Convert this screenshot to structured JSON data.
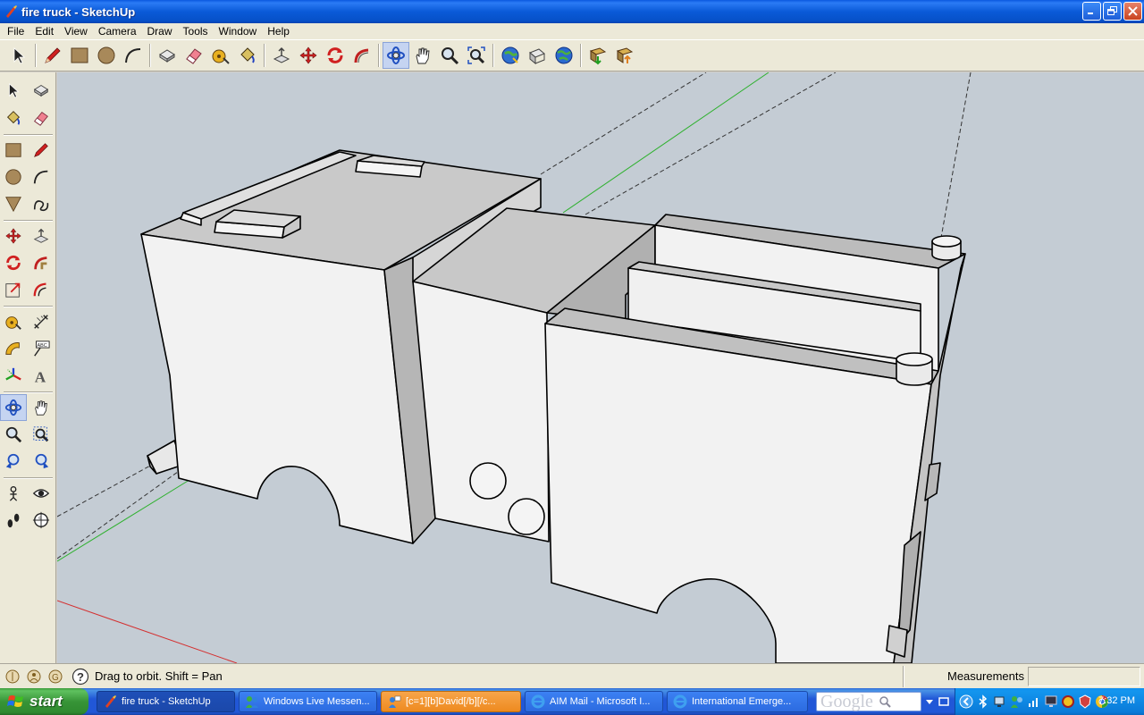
{
  "window": {
    "title": "fire truck - SketchUp",
    "buttons": [
      "minimize",
      "restore",
      "close"
    ]
  },
  "menubar": {
    "items": [
      "File",
      "Edit",
      "View",
      "Camera",
      "Draw",
      "Tools",
      "Window",
      "Help"
    ]
  },
  "top_toolbar": {
    "tools": [
      "select-icon",
      "pencil-icon",
      "rectangle-icon",
      "circle-icon",
      "arc-icon",
      "make-component-icon",
      "eraser-icon",
      "tape-measure-icon",
      "paint-bucket-icon",
      "push-pull-icon",
      "move-icon",
      "rotate-icon",
      "follow-me-icon",
      "orbit-icon",
      "pan-icon",
      "zoom-icon",
      "zoom-extents-icon",
      "get-models-icon",
      "share-model-icon",
      "google-earth-icon",
      "get-current-view-icon",
      "toggle-terrain-icon"
    ],
    "active_tool": "orbit-icon"
  },
  "left_toolbar": {
    "tools": [
      "select-icon",
      "make-component-icon",
      "paint-bucket-icon",
      "eraser-icon",
      "rectangle-icon",
      "line-icon",
      "circle-icon",
      "arc-icon",
      "polygon-icon",
      "freehand-icon",
      "move-icon",
      "push-pull-icon",
      "rotate-icon",
      "follow-me-icon",
      "scale-icon",
      "offset-icon",
      "tape-measure-icon",
      "dimension-icon",
      "protractor-icon",
      "text-icon",
      "axes-icon",
      "3d-text-icon",
      "orbit-icon",
      "pan-icon",
      "zoom-icon",
      "zoom-window-icon",
      "previous-view-icon",
      "next-view-icon",
      "position-camera-icon",
      "look-around-icon",
      "walk-icon",
      "section-plane-icon"
    ],
    "active_tool": "orbit-icon"
  },
  "status": {
    "hint": "Drag to orbit.  Shift = Pan",
    "measurements_label": "Measurements",
    "measurements_value": ""
  },
  "taskbar": {
    "start_label": "start",
    "tasks": [
      {
        "label": "fire truck - SketchUp",
        "state": "active"
      },
      {
        "label": "Windows Live Messen...",
        "state": "normal"
      },
      {
        "label": "[c=1][b]David[/b][/c...",
        "state": "flash"
      },
      {
        "label": "AIM Mail - Microsoft I...",
        "state": "normal"
      },
      {
        "label": "International Emerge...",
        "state": "normal"
      }
    ],
    "search_brand": "Google",
    "clock": "7:32 PM"
  },
  "colors": {
    "viewport_bg": "#c4ccd4",
    "face_white": "#f2f2f2",
    "face_shade": "#c8c8c8",
    "face_dark": "#a8a8a8",
    "axis_green": "#2fb12f",
    "axis_red": "#d43030"
  }
}
